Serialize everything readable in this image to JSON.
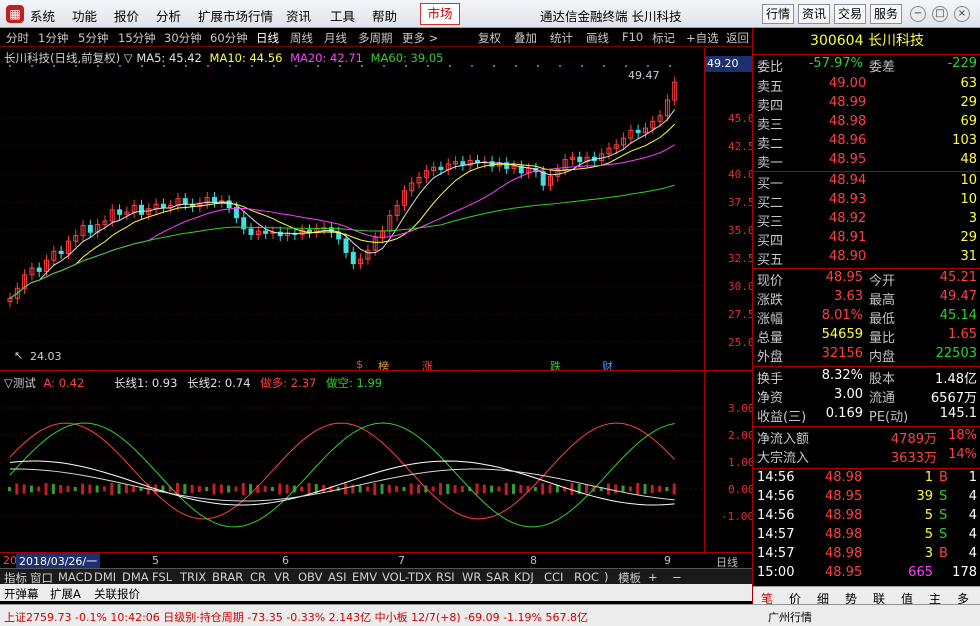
{
  "menubar": {
    "items": [
      "系统",
      "功能",
      "报价",
      "分析",
      "扩展市场行情",
      "资讯",
      "工具",
      "帮助"
    ],
    "market_label": "市场",
    "app_title": "通达信金融终端  长川科技",
    "buttons": [
      "行情",
      "资讯",
      "交易",
      "服务"
    ]
  },
  "periods": [
    "分时",
    "1分钟",
    "5分钟",
    "15分钟",
    "30分钟",
    "60分钟",
    "日线",
    "周线",
    "月线",
    "多周期",
    "更多 >"
  ],
  "active_period": "日线",
  "tools": [
    "复权",
    "叠加",
    "统计",
    "画线",
    "F10",
    "标记",
    "+自选",
    "返回"
  ],
  "chart_header": {
    "title": "长川科技(日线,前复权)",
    "ma5": "MA5: 45.42",
    "ma10": "MA10: 44.56",
    "ma20": "MA20: 42.71",
    "ma60": "MA60: 39.05"
  },
  "chart_labels": {
    "high_mark": "49.47",
    "low_mark": "24.03",
    "current_price_tag": "49.20",
    "event_marks": [
      "$",
      "榜",
      "涨",
      "跌",
      "财"
    ]
  },
  "indicator_header": {
    "name": "▽测试",
    "a": "A: 0.42",
    "l1": "长线1: 0.93",
    "l2": "长线2: 0.74",
    "do_long": "做多: 2.37",
    "do_short": "做空: 1.99"
  },
  "date_axis": {
    "cursor_date": "2018/03/26/一",
    "marks": [
      "20",
      "5",
      "6",
      "7",
      "8",
      "9"
    ],
    "period_label": "日线"
  },
  "indicator_tabs": [
    "指标",
    "窗口",
    "MACD",
    "DMI",
    "DMA",
    "FSL",
    "TRIX",
    "BRAR",
    "CR",
    "VR",
    "OBV",
    "ASI",
    "EMV",
    "VOL-TDX",
    "RSI",
    "WR",
    "SAR",
    "KDJ",
    "CCI",
    "ROC",
    ")",
    "模板",
    "+",
    "−"
  ],
  "sub_tabs": [
    "开弹幕",
    "扩展A",
    "关联报价"
  ],
  "quote": {
    "code": "300604",
    "name": "长川科技",
    "weibi_label": "委比",
    "weibi": "-57.97%",
    "weicha_label": "委差",
    "weicha": "-229",
    "asks": [
      {
        "label": "卖五",
        "price": "49.00",
        "vol": "63"
      },
      {
        "label": "卖四",
        "price": "48.99",
        "vol": "29"
      },
      {
        "label": "卖三",
        "price": "48.98",
        "vol": "69"
      },
      {
        "label": "卖二",
        "price": "48.96",
        "vol": "103"
      },
      {
        "label": "卖一",
        "price": "48.95",
        "vol": "48"
      }
    ],
    "bids": [
      {
        "label": "买一",
        "price": "48.94",
        "vol": "10"
      },
      {
        "label": "买二",
        "price": "48.93",
        "vol": "10"
      },
      {
        "label": "买三",
        "price": "48.92",
        "vol": "3"
      },
      {
        "label": "买四",
        "price": "48.91",
        "vol": "29"
      },
      {
        "label": "买五",
        "price": "48.90",
        "vol": "31"
      }
    ],
    "stats": [
      {
        "l1": "现价",
        "v1": "48.95",
        "l2": "今开",
        "v2": "45.21"
      },
      {
        "l1": "涨跌",
        "v1": "3.63",
        "l2": "最高",
        "v2": "49.47"
      },
      {
        "l1": "涨幅",
        "v1": "8.01%",
        "l2": "最低",
        "v2": "45.14"
      },
      {
        "l1": "总量",
        "v1": "54659",
        "l2": "量比",
        "v2": "1.65"
      },
      {
        "l1": "外盘",
        "v1": "32156",
        "l2": "内盘",
        "v2": "22503"
      }
    ],
    "stats2": [
      {
        "l1": "换手",
        "v1": "8.32%",
        "l2": "股本",
        "v2": "1.48亿"
      },
      {
        "l1": "净资",
        "v1": "3.00",
        "l2": "流通",
        "v2": "6567万"
      },
      {
        "l1": "收益(三)",
        "v1": "0.169",
        "l2": "PE(动)",
        "v2": "145.1"
      }
    ],
    "flows": [
      {
        "label": "净流入额",
        "value": "4789万",
        "pct": "18%"
      },
      {
        "label": "大宗流入",
        "value": "3633万",
        "pct": "14%"
      }
    ],
    "ticks": [
      {
        "time": "14:56",
        "price": "48.98",
        "vol": "1",
        "bs": "B",
        "n": "1"
      },
      {
        "time": "14:56",
        "price": "48.95",
        "vol": "39",
        "bs": "S",
        "n": "4"
      },
      {
        "time": "14:56",
        "price": "48.98",
        "vol": "5",
        "bs": "S",
        "n": "4"
      },
      {
        "time": "14:57",
        "price": "48.98",
        "vol": "5",
        "bs": "S",
        "n": "4"
      },
      {
        "time": "14:57",
        "price": "48.98",
        "vol": "3",
        "bs": "B",
        "n": "4"
      },
      {
        "time": "15:00",
        "price": "48.95",
        "vol": "665",
        "bs": "",
        "n": "178"
      }
    ],
    "bottom_tabs": [
      "笔",
      "价",
      "细",
      "势",
      "联",
      "值",
      "主",
      "多"
    ],
    "region_tab": "广州行情"
  },
  "statusbar": {
    "text": "上证2759.73  -0.1%  10:42:06 日级别·持仓周期 -73.35  -0.33%  2.143亿  中小板  12/7(+8)  -69.09  -1.19%  567.8亿"
  },
  "price_axis": [
    "45.00",
    "42.50",
    "40.00",
    "37.50",
    "35.00",
    "32.50",
    "30.00",
    "27.50",
    "25.00"
  ],
  "ind_axis": [
    "3.00",
    "2.00",
    "1.00",
    "0.00",
    "-1.00"
  ]
}
